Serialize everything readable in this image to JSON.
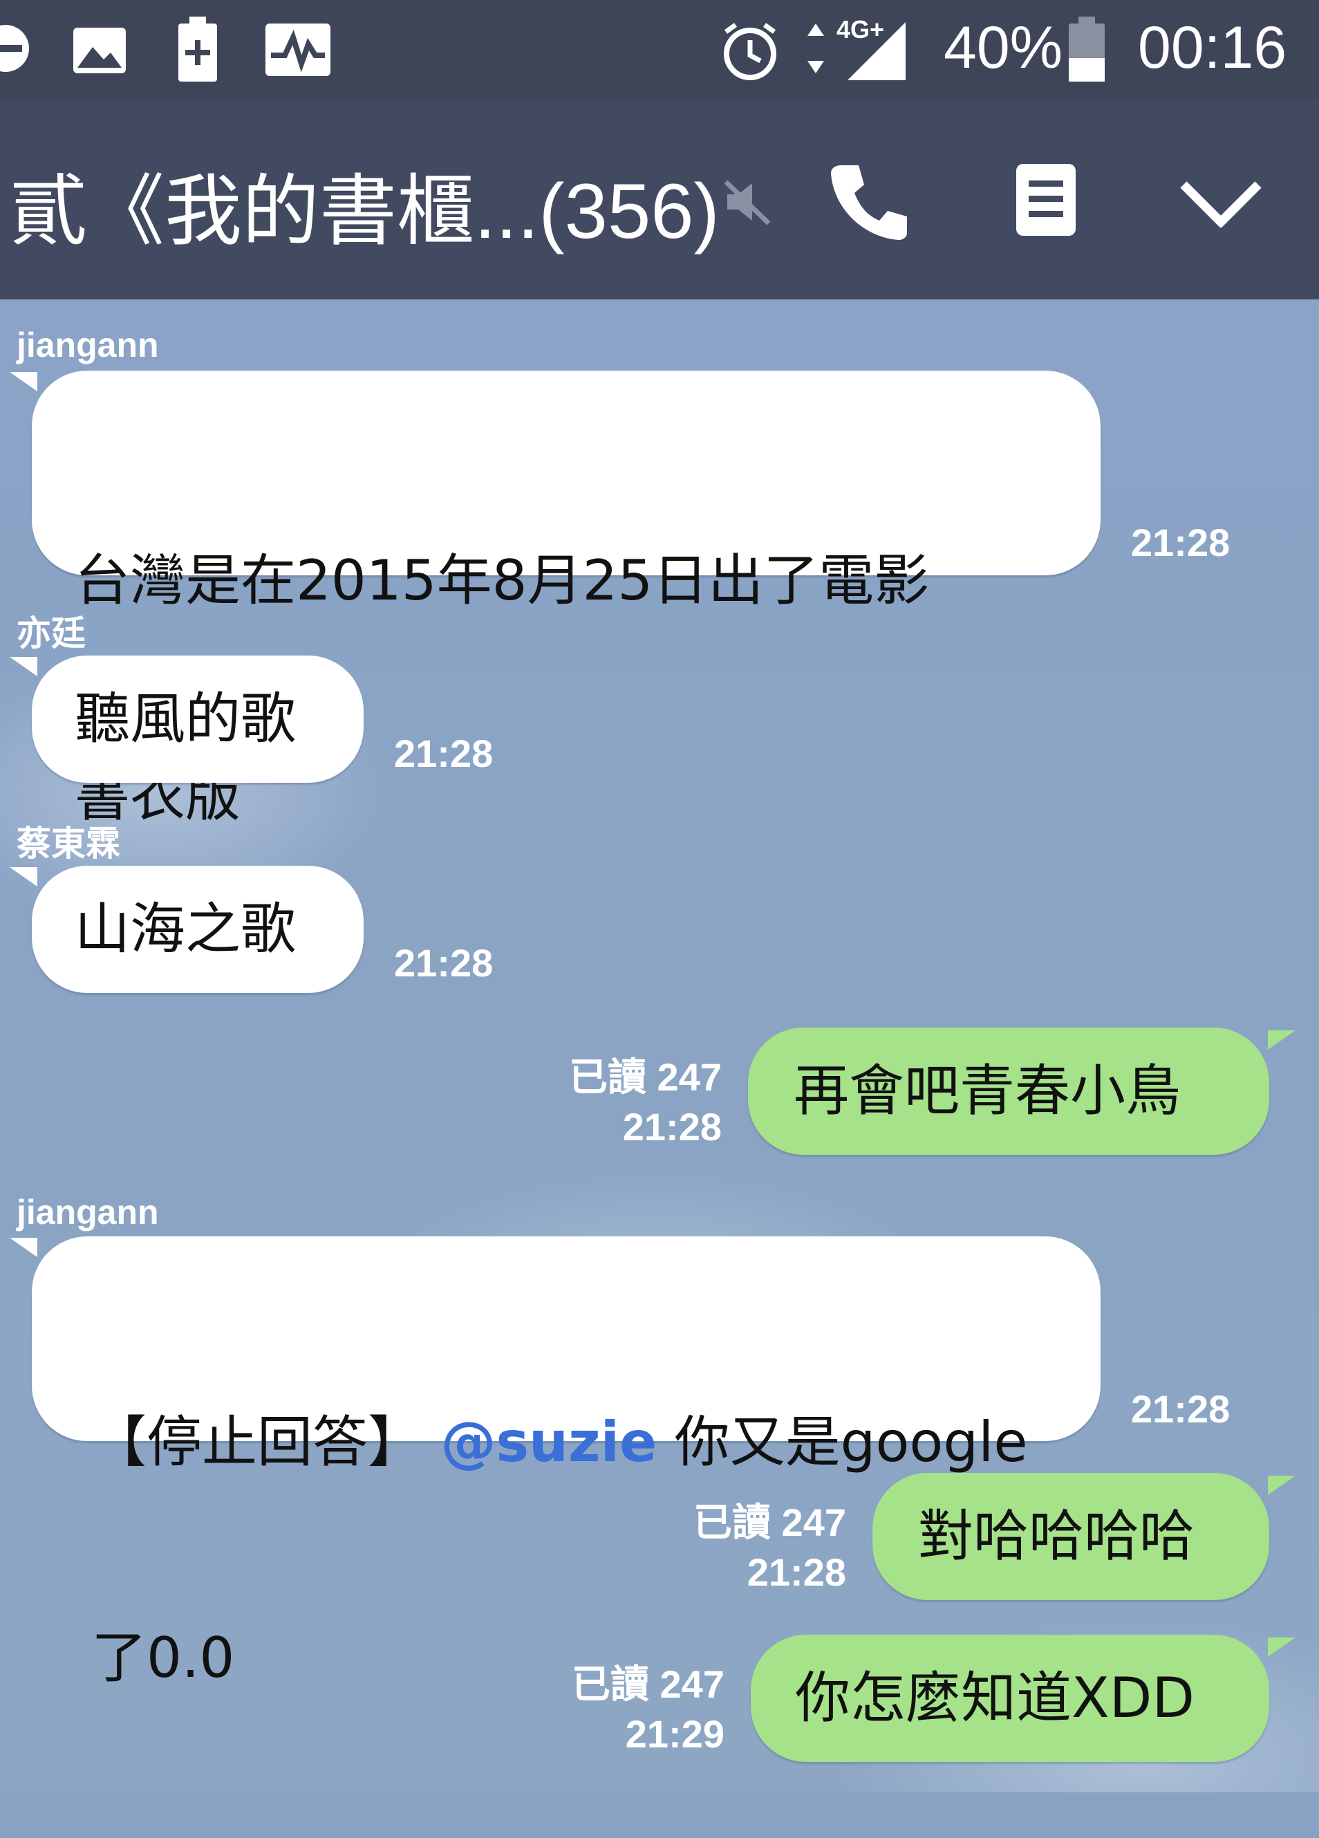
{
  "status_bar": {
    "battery_percent": "40%",
    "clock": "00:16",
    "network": "4G+",
    "icons": [
      "minus-circle-icon",
      "image-icon",
      "battery-plus-icon",
      "activity-icon",
      "alarm-icon",
      "signal-icon",
      "battery-icon"
    ]
  },
  "header": {
    "title": "貳《我的書櫃...",
    "member_count": "(356)",
    "icons": [
      "mute-icon",
      "phone-icon",
      "notes-icon",
      "chevron-down-icon"
    ]
  },
  "messages": [
    {
      "sender": "jiangann",
      "text_line1": "台灣是在2015年8月25日出了電影",
      "text_line2": "書衣版",
      "time": "21:28"
    },
    {
      "sender": "亦廷",
      "text": "聽風的歌",
      "time": "21:28"
    },
    {
      "sender": "蔡東霖",
      "text": "山海之歌",
      "time": "21:28"
    },
    {
      "read": "已讀 247",
      "time": "21:28",
      "text": "再會吧青春小鳥"
    },
    {
      "sender": "jiangann",
      "prefix": "【停止回答】 ",
      "mention": "@suzie",
      "suffix": " 你又是google",
      "text_line2": "了0.0",
      "time": "21:28"
    },
    {
      "read": "已讀 247",
      "time": "21:28",
      "text": "對哈哈哈哈"
    },
    {
      "read": "已讀 247",
      "time": "21:29",
      "text": "你怎麼知道XDD"
    }
  ],
  "colors": {
    "status_bar": "#3e4558",
    "header": "#414a60",
    "chat_bg": "#88a2c4",
    "incoming": "#ffffff",
    "outgoing": "#a5e28a",
    "mention": "#3a6fd8"
  }
}
